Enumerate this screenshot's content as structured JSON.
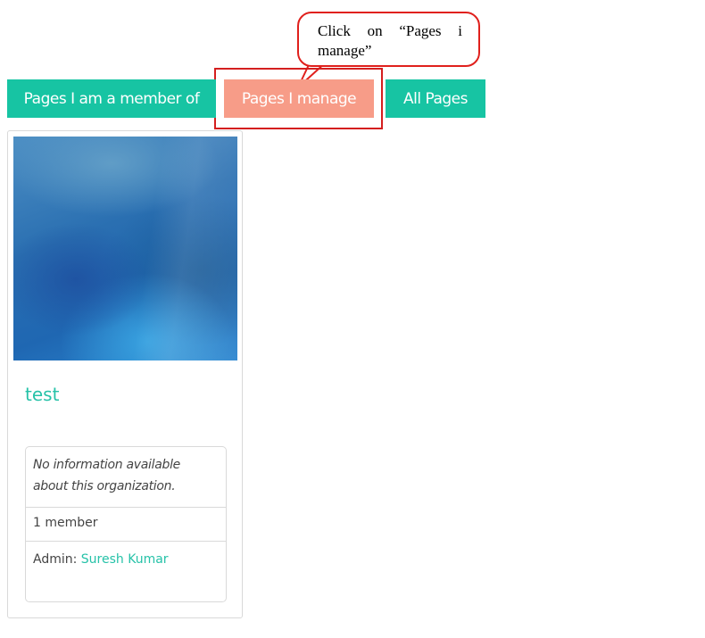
{
  "annotation": {
    "callout_text": "Click on “Pages i manage”",
    "border_color": "#e0201c"
  },
  "tabs": [
    {
      "label": "Pages I am a member of",
      "state": "normal"
    },
    {
      "label": "Pages I manage",
      "state": "active"
    },
    {
      "label": "All Pages",
      "state": "normal"
    }
  ],
  "colors": {
    "accent": "#17c4a3",
    "active_tab": "#f79c88",
    "link": "#26c2a8"
  },
  "card": {
    "title": "test",
    "description": "No information available about this organization.",
    "members": "1 member",
    "admin_label": "Admin: ",
    "admin_name": "Suresh Kumar"
  }
}
